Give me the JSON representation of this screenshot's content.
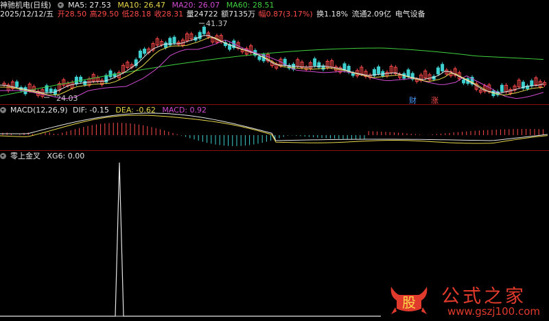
{
  "header": {
    "stock_name": "神驰机电",
    "period": "(日线)",
    "ma5": "MA5: 27.53",
    "ma10": "MA10: 26.47",
    "ma20": "MA20: 26.07",
    "ma60": "MA60: 28.51",
    "date": "2025/12/12/五",
    "open": "开28.50",
    "high": "高29.50",
    "low": "低28.18",
    "close": "收28.31",
    "volume": "量24722",
    "amount": "额7135万",
    "change": "幅0.87(3.17%)",
    "turnover": "换1.18%",
    "float_cap": "流通2.09亿",
    "sector": "电气设备"
  },
  "price_panel": {
    "high_marker": "41.37",
    "low_marker": "24.03",
    "badge_cai": "财",
    "badge_zhang": "涨"
  },
  "macd_panel": {
    "title": "MACD(12,26,9)",
    "dif": "DIF: -0.15",
    "dea": "DEA: -0.62",
    "macd": "MACD: 0.92"
  },
  "signal_panel": {
    "title": "零上金叉",
    "xg": "XG6: 0.00"
  },
  "watermark": {
    "glyph": "股",
    "name": "公式之家",
    "url": "www.gszj100.com"
  },
  "colors": {
    "background": "#000000",
    "ma5": "#e6e6e6",
    "ma10": "#e6d64a",
    "ma20": "#d14bd1",
    "ma60": "#3fd03f",
    "up": "#ff4a4a",
    "down": "#3fd0d0",
    "separator": "#8a1010"
  }
}
